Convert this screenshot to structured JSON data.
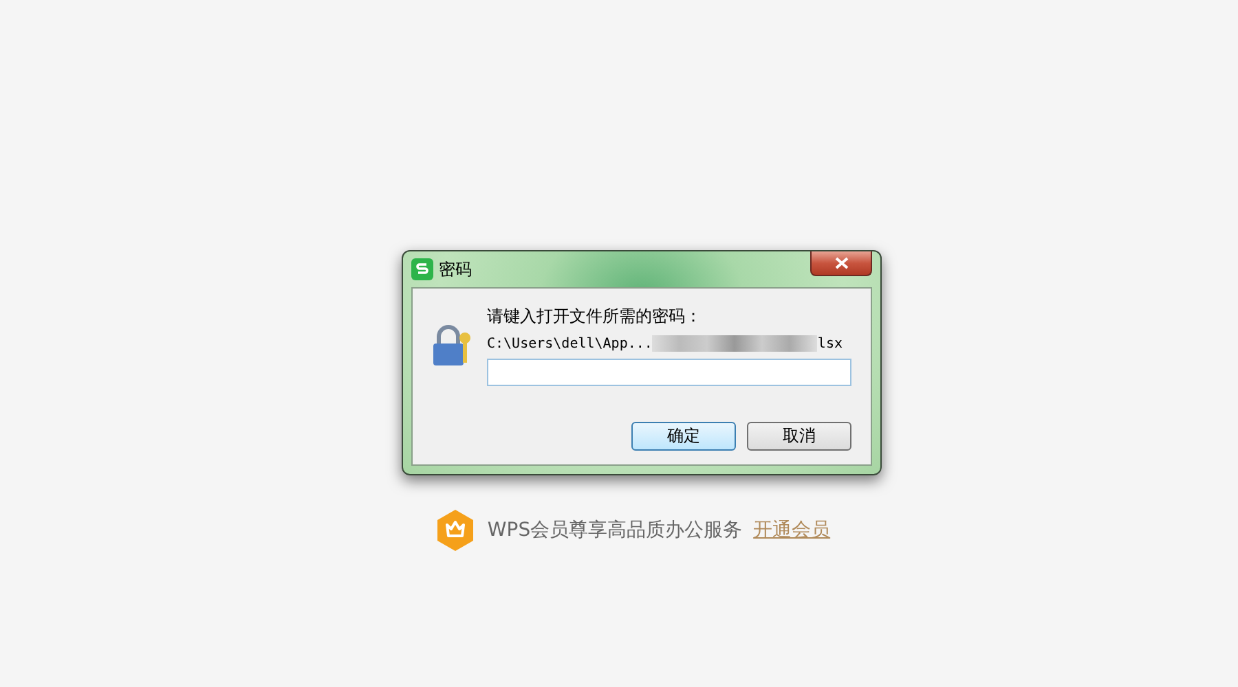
{
  "dialog": {
    "title": "密码",
    "prompt": "请键入打开文件所需的密码：",
    "path_start": "C:\\Users\\dell\\App...",
    "path_end": "lsx",
    "password": {
      "focused": true
    },
    "buttons": [
      {
        "label": "确定",
        "kind": "primary"
      },
      {
        "label": "取消",
        "kind": "normal"
      }
    ]
  },
  "promo": {
    "text": "WPS会员尊享高品质办公服务",
    "link": "开通会员"
  }
}
